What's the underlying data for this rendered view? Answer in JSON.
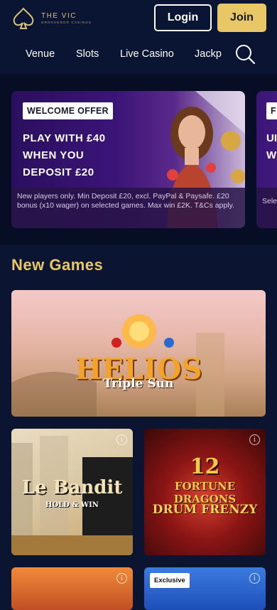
{
  "brand": {
    "name": "THE VIC",
    "sub": "GROSVENOR CASINOS"
  },
  "header": {
    "login_label": "Login",
    "join_label": "Join"
  },
  "nav": {
    "items": [
      "Venue",
      "Slots",
      "Live Casino",
      "Jackp"
    ]
  },
  "promo": {
    "badge": "WELCOME OFFER",
    "lines": [
      "PLAY WITH £40",
      "WHEN YOU",
      "DEPOSIT £20"
    ],
    "terms": "New players only. Min Deposit £20, excl. PayPal & Paysafe. £20 bonus (x10 wager) on selected games. Max win £2K. T&Cs apply.",
    "card2": {
      "badge": "F",
      "lines": [
        "UI",
        "W"
      ],
      "terms": "Sele vary"
    }
  },
  "section": {
    "title": "New Games"
  },
  "games": [
    {
      "title": "HELIOS",
      "subtitle": "Triple Sun"
    },
    {
      "title": "Le Bandit",
      "subtitle": "HOLD & WIN"
    },
    {
      "number": "12",
      "title": "FORTUNE DRAGONS",
      "subtitle": "DRUM FRENZY"
    },
    {
      "badge": ""
    },
    {
      "badge": "Exclusive"
    }
  ],
  "colors": {
    "accent": "#e8c766",
    "header_bg": "#0a1533",
    "page_bg": "#0b1430"
  }
}
